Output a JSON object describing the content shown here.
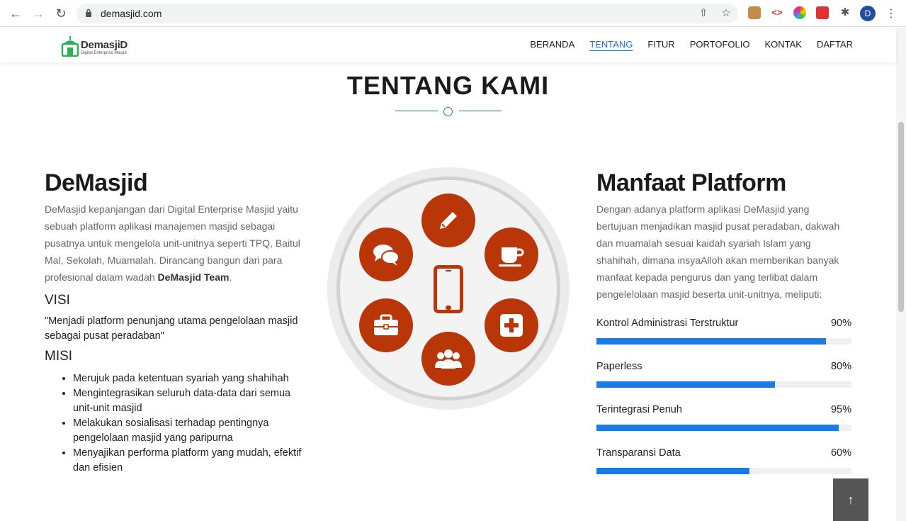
{
  "browser": {
    "url": "demasjid.com",
    "profile_initial": "D"
  },
  "site": {
    "logo_name": "DemasjiD",
    "logo_tagline": "Digital Enterprise Masjid",
    "nav": [
      "Beranda",
      "Tentang",
      "Fitur",
      "Portofolio",
      "Kontak",
      "Daftar"
    ],
    "nav_active": "Tentang"
  },
  "section": {
    "title": "TENTANG KAMI"
  },
  "about": {
    "title": "DeMasjid",
    "description": "DeMasjid kepanjangan dari Digital Enterprise Masjid yaitu sebuah platform aplikasi manajemen masjid sebagai pusatnya untuk mengelola unit-unitnya seperti TPQ, Baitul Mal, Sekolah, Muamalah. Dirancang bangun dari para profesional dalam wadah ",
    "team_name": "DeMasjid Team",
    "period": ".",
    "visi_heading": "VISI",
    "visi_text": "\"Menjadi platform penunjang utama pengelolaan masjid sebagai pusat peradaban\"",
    "misi_heading": "MISI",
    "misi_items": [
      "Merujuk pada ketentuan syariah yang shahihah",
      "Mengintegrasikan seluruh data-data dari semua unit-unit masjid",
      "Melakukan sosialisasi terhadap pentingnya pengelolaan masjid yang paripurna",
      "Menyajikan performa platform yang mudah, efektif dan efisien"
    ]
  },
  "benefits": {
    "title": "Manfaat Platform",
    "description": "Dengan adanya platform aplikasi DeMasjid yang bertujuan menjadikan masjid pusat peradaban, dakwah dan muamalah sesuai kaidah syariah Islam yang shahihah, dimana insyaAlloh akan memberikan banyak manfaat kepada pengurus dan yang terlibat dalam pengelelolaan masjid beserta unit-unitnya, meliputi:",
    "items": [
      {
        "label": "Kontrol Administrasi Terstruktur",
        "percent_text": "90%",
        "value": 90
      },
      {
        "label": "Paperless",
        "percent_text": "80%",
        "value": 70
      },
      {
        "label": "Terintegrasi Penuh",
        "percent_text": "95%",
        "value": 95
      },
      {
        "label": "Transparansi Data",
        "percent_text": "60%",
        "value": 60
      }
    ]
  },
  "colors": {
    "accent": "#1a73c9",
    "bar": "#1a7ae6",
    "icon": "#b83608"
  },
  "back_to_top": "↑"
}
